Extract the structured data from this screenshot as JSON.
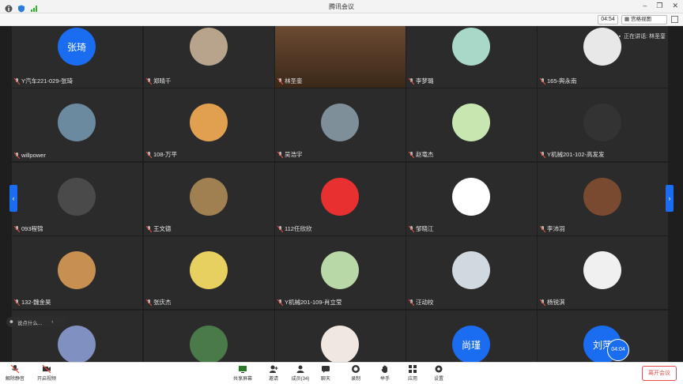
{
  "window": {
    "title": "腾讯会议",
    "timer": "04:54",
    "view_mode": "宫格视图"
  },
  "stage": {
    "speaking_text": "正在讲话: 林圣銮",
    "chat_placeholder": "说点什么...",
    "self_timer": "04:04"
  },
  "participants": [
    {
      "name": "Y汽车221-029-张琦",
      "avatar_text": "张琦",
      "avatar_color": "#1a6cf0"
    },
    {
      "name": "郑晴千",
      "avatar_text": "",
      "avatar_color": "#b8a38c"
    },
    {
      "name": "林圣銮",
      "avatar_text": "",
      "avatar_color": "#5a4030"
    },
    {
      "name": "李梦璐",
      "avatar_text": "",
      "avatar_color": "#a8d8c8"
    },
    {
      "name": "165-舆永南",
      "avatar_text": "",
      "avatar_color": "#e8e8e8"
    },
    {
      "name": "willpower",
      "avatar_text": "",
      "avatar_color": "#6b8aa0"
    },
    {
      "name": "108-万平",
      "avatar_text": "",
      "avatar_color": "#e0a050"
    },
    {
      "name": "吴浩宇",
      "avatar_text": "",
      "avatar_color": "#7f8f9a"
    },
    {
      "name": "赵竜杰",
      "avatar_text": "",
      "avatar_color": "#c8e6b0"
    },
    {
      "name": "Y机械201-102-高发发",
      "avatar_text": "",
      "avatar_color": "#333333"
    },
    {
      "name": "093程锦",
      "avatar_text": "",
      "avatar_color": "#4a4a4a"
    },
    {
      "name": "王文德",
      "avatar_text": "",
      "avatar_color": "#a08050"
    },
    {
      "name": "112任欣欣",
      "avatar_text": "",
      "avatar_color": "#e83030"
    },
    {
      "name": "邹晓江",
      "avatar_text": "",
      "avatar_color": "#ffffff"
    },
    {
      "name": "李沛羽",
      "avatar_text": "",
      "avatar_color": "#7a4a30"
    },
    {
      "name": "132-魏金昊",
      "avatar_text": "",
      "avatar_color": "#c89050"
    },
    {
      "name": "张庆杰",
      "avatar_text": "",
      "avatar_color": "#e8d060"
    },
    {
      "name": "Y机械201-109-肖立莹",
      "avatar_text": "",
      "avatar_color": "#b8d8a8"
    },
    {
      "name": "汪动校",
      "avatar_text": "",
      "avatar_color": "#d0d8e0"
    },
    {
      "name": "杨锐淇",
      "avatar_text": "",
      "avatar_color": "#f0f0f0"
    },
    {
      "name": "",
      "avatar_text": "",
      "avatar_color": "#8090c0"
    },
    {
      "name": "",
      "avatar_text": "",
      "avatar_color": "#4a7a4a"
    },
    {
      "name": "",
      "avatar_text": "",
      "avatar_color": "#f0e8e0"
    },
    {
      "name": "",
      "avatar_text": "尚瑾",
      "avatar_color": "#1a6cf0"
    },
    {
      "name": "",
      "avatar_text": "刘萍",
      "avatar_color": "#1a6cf0"
    }
  ],
  "toolbar": {
    "unmute": "解除静音",
    "start_video": "开启视频",
    "share_screen": "共享屏幕",
    "invite": "邀请",
    "members": "成员(34)",
    "chat": "聊天",
    "record": "录制",
    "raise_hand": "举手",
    "apps": "应用",
    "settings": "设置",
    "leave": "离开会议"
  }
}
